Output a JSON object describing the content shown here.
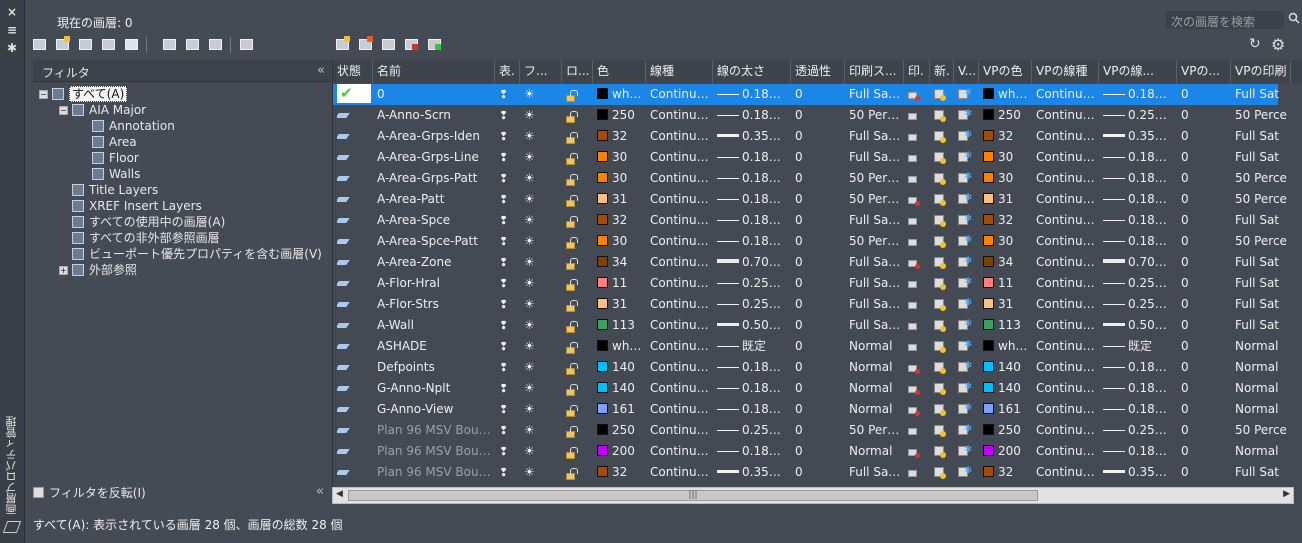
{
  "window": {
    "vertical_title": "画層プロパティ管理",
    "controls": [
      "×",
      "≡",
      "✱"
    ]
  },
  "header": {
    "current_layer": "現在の画層: 0",
    "search_placeholder": "次の画層を検索"
  },
  "filter_panel": {
    "title": "フィルタ",
    "collapse": "«",
    "tree": [
      {
        "label": "すべて(A)",
        "level": 0,
        "expander": "−",
        "selected": true
      },
      {
        "label": "AIA Major",
        "level": 1,
        "expander": "−"
      },
      {
        "label": "Annotation",
        "level": 2
      },
      {
        "label": "Area",
        "level": 2
      },
      {
        "label": "Floor",
        "level": 2
      },
      {
        "label": "Walls",
        "level": 2
      },
      {
        "label": "Title Layers",
        "level": 1
      },
      {
        "label": "XREF Insert Layers",
        "level": 1
      },
      {
        "label": "すべての使用中の画層(A)",
        "level": 1
      },
      {
        "label": "すべての非外部参照画層",
        "level": 1
      },
      {
        "label": "ビューポート優先プロパティを含む画層(V)",
        "level": 1
      },
      {
        "label": "外部参照",
        "level": 1,
        "expander": "+"
      }
    ],
    "invert_label": "フィルタを反転(I)"
  },
  "status_bar": "すべて(A): 表示されている画層 28 個、画層の総数 28 個",
  "columns": [
    "状態",
    "名前",
    "表.",
    "フ...",
    "ロ...",
    "色",
    "線種",
    "線の太さ",
    "透過性",
    "印刷ス...",
    "印.",
    "新.",
    "V...",
    "VPの色",
    "VPの線種",
    "VPの線...",
    "VPの...",
    "VPの印刷"
  ],
  "rows": [
    {
      "name": "0",
      "colorname": "wh…",
      "swatch": "#000000",
      "ltype": "Continu…",
      "lw": "0.18…",
      "lwh": 1,
      "tr": "0",
      "pstyle": "Full Sa…",
      "plot_off": true,
      "vpcolor": "wh…",
      "vpswatch": "#000000",
      "vpltype": "Continu…",
      "vplw": "0.18…",
      "vplwh": 1,
      "vptr": "0",
      "vpps": "Full Sat",
      "selected": true
    },
    {
      "name": "A-Anno-Scrn",
      "colorname": "250",
      "swatch": "#000000",
      "ltype": "Continu…",
      "lw": "0.18…",
      "lwh": 1,
      "tr": "0",
      "pstyle": "50 Per…",
      "plot_off": false,
      "vpcolor": "250",
      "vpswatch": "#000000",
      "vpltype": "Continu…",
      "vplw": "0.25…",
      "vplwh": 1,
      "vptr": "0",
      "vpps": "50 Perce"
    },
    {
      "name": "A-Area-Grps-Iden",
      "colorname": "32",
      "swatch": "#a64b06",
      "ltype": "Continu…",
      "lw": "0.35…",
      "lwh": 3,
      "tr": "0",
      "pstyle": "Full Sa…",
      "plot_off": false,
      "vpcolor": "32",
      "vpswatch": "#a64b06",
      "vpltype": "Continu…",
      "vplw": "0.35…",
      "vplwh": 3,
      "vptr": "0",
      "vpps": "Full Sat"
    },
    {
      "name": "A-Area-Grps-Line",
      "colorname": "30",
      "swatch": "#ff7f00",
      "ltype": "Continu…",
      "lw": "0.18…",
      "lwh": 1,
      "tr": "0",
      "pstyle": "Full Sa…",
      "plot_off": false,
      "vpcolor": "30",
      "vpswatch": "#ff7f00",
      "vpltype": "Continu…",
      "vplw": "0.18…",
      "vplwh": 1,
      "vptr": "0",
      "vpps": "Full Sat"
    },
    {
      "name": "A-Area-Grps-Patt",
      "colorname": "30",
      "swatch": "#ff7f00",
      "ltype": "Continu…",
      "lw": "0.18…",
      "lwh": 1,
      "tr": "0",
      "pstyle": "50 Per…",
      "plot_off": false,
      "vpcolor": "30",
      "vpswatch": "#ff7f00",
      "vpltype": "Continu…",
      "vplw": "0.18…",
      "vplwh": 1,
      "vptr": "0",
      "vpps": "50 Perce"
    },
    {
      "name": "A-Area-Patt",
      "colorname": "31",
      "swatch": "#ffbf7f",
      "ltype": "Continu…",
      "lw": "0.18…",
      "lwh": 1,
      "tr": "0",
      "pstyle": "50 Per…",
      "plot_off": true,
      "vpcolor": "31",
      "vpswatch": "#ffbf7f",
      "vpltype": "Continu…",
      "vplw": "0.18…",
      "vplwh": 1,
      "vptr": "0",
      "vpps": "50 Perce"
    },
    {
      "name": "A-Area-Spce",
      "colorname": "32",
      "swatch": "#a64b06",
      "ltype": "Continu…",
      "lw": "0.18…",
      "lwh": 1,
      "tr": "0",
      "pstyle": "Full Sa…",
      "plot_off": false,
      "vpcolor": "32",
      "vpswatch": "#a64b06",
      "vpltype": "Continu…",
      "vplw": "0.18…",
      "vplwh": 1,
      "vptr": "0",
      "vpps": "Full Sat"
    },
    {
      "name": "A-Area-Spce-Patt",
      "colorname": "30",
      "swatch": "#ff7f00",
      "ltype": "Continu…",
      "lw": "0.18…",
      "lwh": 1,
      "tr": "0",
      "pstyle": "50 Per…",
      "plot_off": false,
      "vpcolor": "30",
      "vpswatch": "#ff7f00",
      "vpltype": "Continu…",
      "vplw": "0.18…",
      "vplwh": 1,
      "vptr": "0",
      "vpps": "50 Perce"
    },
    {
      "name": "A-Area-Zone",
      "colorname": "34",
      "swatch": "#7f3f00",
      "ltype": "Continu…",
      "lw": "0.70…",
      "lwh": 4,
      "tr": "0",
      "pstyle": "Full Sa…",
      "plot_off": true,
      "vpcolor": "34",
      "vpswatch": "#7f3f00",
      "vpltype": "Continu…",
      "vplw": "0.70…",
      "vplwh": 4,
      "vptr": "0",
      "vpps": "Full Sat"
    },
    {
      "name": "A-Flor-Hral",
      "colorname": "11",
      "swatch": "#ff7f7f",
      "ltype": "Continu…",
      "lw": "0.25…",
      "lwh": 1,
      "tr": "0",
      "pstyle": "Full Sa…",
      "plot_off": false,
      "vpcolor": "11",
      "vpswatch": "#ff7f7f",
      "vpltype": "Continu…",
      "vplw": "0.25…",
      "vplwh": 1,
      "vptr": "0",
      "vpps": "Full Sat"
    },
    {
      "name": "A-Flor-Strs",
      "colorname": "31",
      "swatch": "#ffbf7f",
      "ltype": "Continu…",
      "lw": "0.25…",
      "lwh": 1,
      "tr": "0",
      "pstyle": "Full Sa…",
      "plot_off": false,
      "vpcolor": "31",
      "vpswatch": "#ffbf7f",
      "vpltype": "Continu…",
      "vplw": "0.25…",
      "vplwh": 1,
      "vptr": "0",
      "vpps": "Full Sat"
    },
    {
      "name": "A-Wall",
      "colorname": "113",
      "swatch": "#3f9f5f",
      "ltype": "Continu…",
      "lw": "0.50…",
      "lwh": 3,
      "tr": "0",
      "pstyle": "Full Sa…",
      "plot_off": false,
      "vpcolor": "113",
      "vpswatch": "#3f9f5f",
      "vpltype": "Continu…",
      "vplw": "0.50…",
      "vplwh": 3,
      "vptr": "0",
      "vpps": "Full Sat"
    },
    {
      "name": "ASHADE",
      "colorname": "wh…",
      "swatch": "#000000",
      "ltype": "Continu…",
      "lw": "既定",
      "lwh": 1,
      "tr": "0",
      "pstyle": "Normal",
      "plot_off": false,
      "vpcolor": "wh…",
      "vpswatch": "#000000",
      "vpltype": "Continu…",
      "vplw": "既定",
      "vplwh": 1,
      "vptr": "0",
      "vpps": "Normal"
    },
    {
      "name": "Defpoints",
      "colorname": "140",
      "swatch": "#00bfff",
      "ltype": "Continu…",
      "lw": "0.18…",
      "lwh": 1,
      "tr": "0",
      "pstyle": "Normal",
      "plot_off": true,
      "vpcolor": "140",
      "vpswatch": "#00bfff",
      "vpltype": "Continu…",
      "vplw": "0.18…",
      "vplwh": 1,
      "vptr": "0",
      "vpps": "Normal"
    },
    {
      "name": "G-Anno-Nplt",
      "colorname": "140",
      "swatch": "#00bfff",
      "ltype": "Continu…",
      "lw": "0.18…",
      "lwh": 1,
      "tr": "0",
      "pstyle": "Normal",
      "plot_off": true,
      "vpcolor": "140",
      "vpswatch": "#00bfff",
      "vpltype": "Continu…",
      "vplw": "0.18…",
      "vplwh": 1,
      "vptr": "0",
      "vpps": "Normal"
    },
    {
      "name": "G-Anno-View",
      "colorname": "161",
      "swatch": "#7f9fff",
      "ltype": "Continu…",
      "lw": "0.18…",
      "lwh": 1,
      "tr": "0",
      "pstyle": "Normal",
      "plot_off": true,
      "vpcolor": "161",
      "vpswatch": "#7f9fff",
      "vpltype": "Continu…",
      "vplw": "0.18…",
      "vplwh": 1,
      "vptr": "0",
      "vpps": "Normal"
    },
    {
      "name": "Plan 96 MSV Bou…",
      "colorname": "250",
      "swatch": "#000000",
      "ltype": "Continu…",
      "lw": "0.25…",
      "lwh": 1,
      "tr": "0",
      "pstyle": "50 Per…",
      "plot_off": false,
      "vpcolor": "250",
      "vpswatch": "#000000",
      "vpltype": "Continu…",
      "vplw": "0.25…",
      "vplwh": 1,
      "vptr": "0",
      "vpps": "50 Perce",
      "gray": true
    },
    {
      "name": "Plan 96 MSV Bou…",
      "colorname": "200",
      "swatch": "#bf00ff",
      "ltype": "Continu…",
      "lw": "0.18…",
      "lwh": 1,
      "tr": "0",
      "pstyle": "Normal",
      "plot_off": true,
      "vpcolor": "200",
      "vpswatch": "#bf00ff",
      "vpltype": "Continu…",
      "vplw": "0.18…",
      "vplwh": 1,
      "vptr": "0",
      "vpps": "Normal",
      "gray": true
    },
    {
      "name": "Plan 96 MSV Bou…",
      "colorname": "32",
      "swatch": "#a64b06",
      "ltype": "Continu…",
      "lw": "0.35…",
      "lwh": 3,
      "tr": "0",
      "pstyle": "Full Sa…",
      "plot_off": false,
      "vpcolor": "32",
      "vpswatch": "#a64b06",
      "vpltype": "Continu…",
      "vplw": "0.35…",
      "vplwh": 3,
      "vptr": "0",
      "vpps": "Full Sat",
      "gray": true
    }
  ]
}
